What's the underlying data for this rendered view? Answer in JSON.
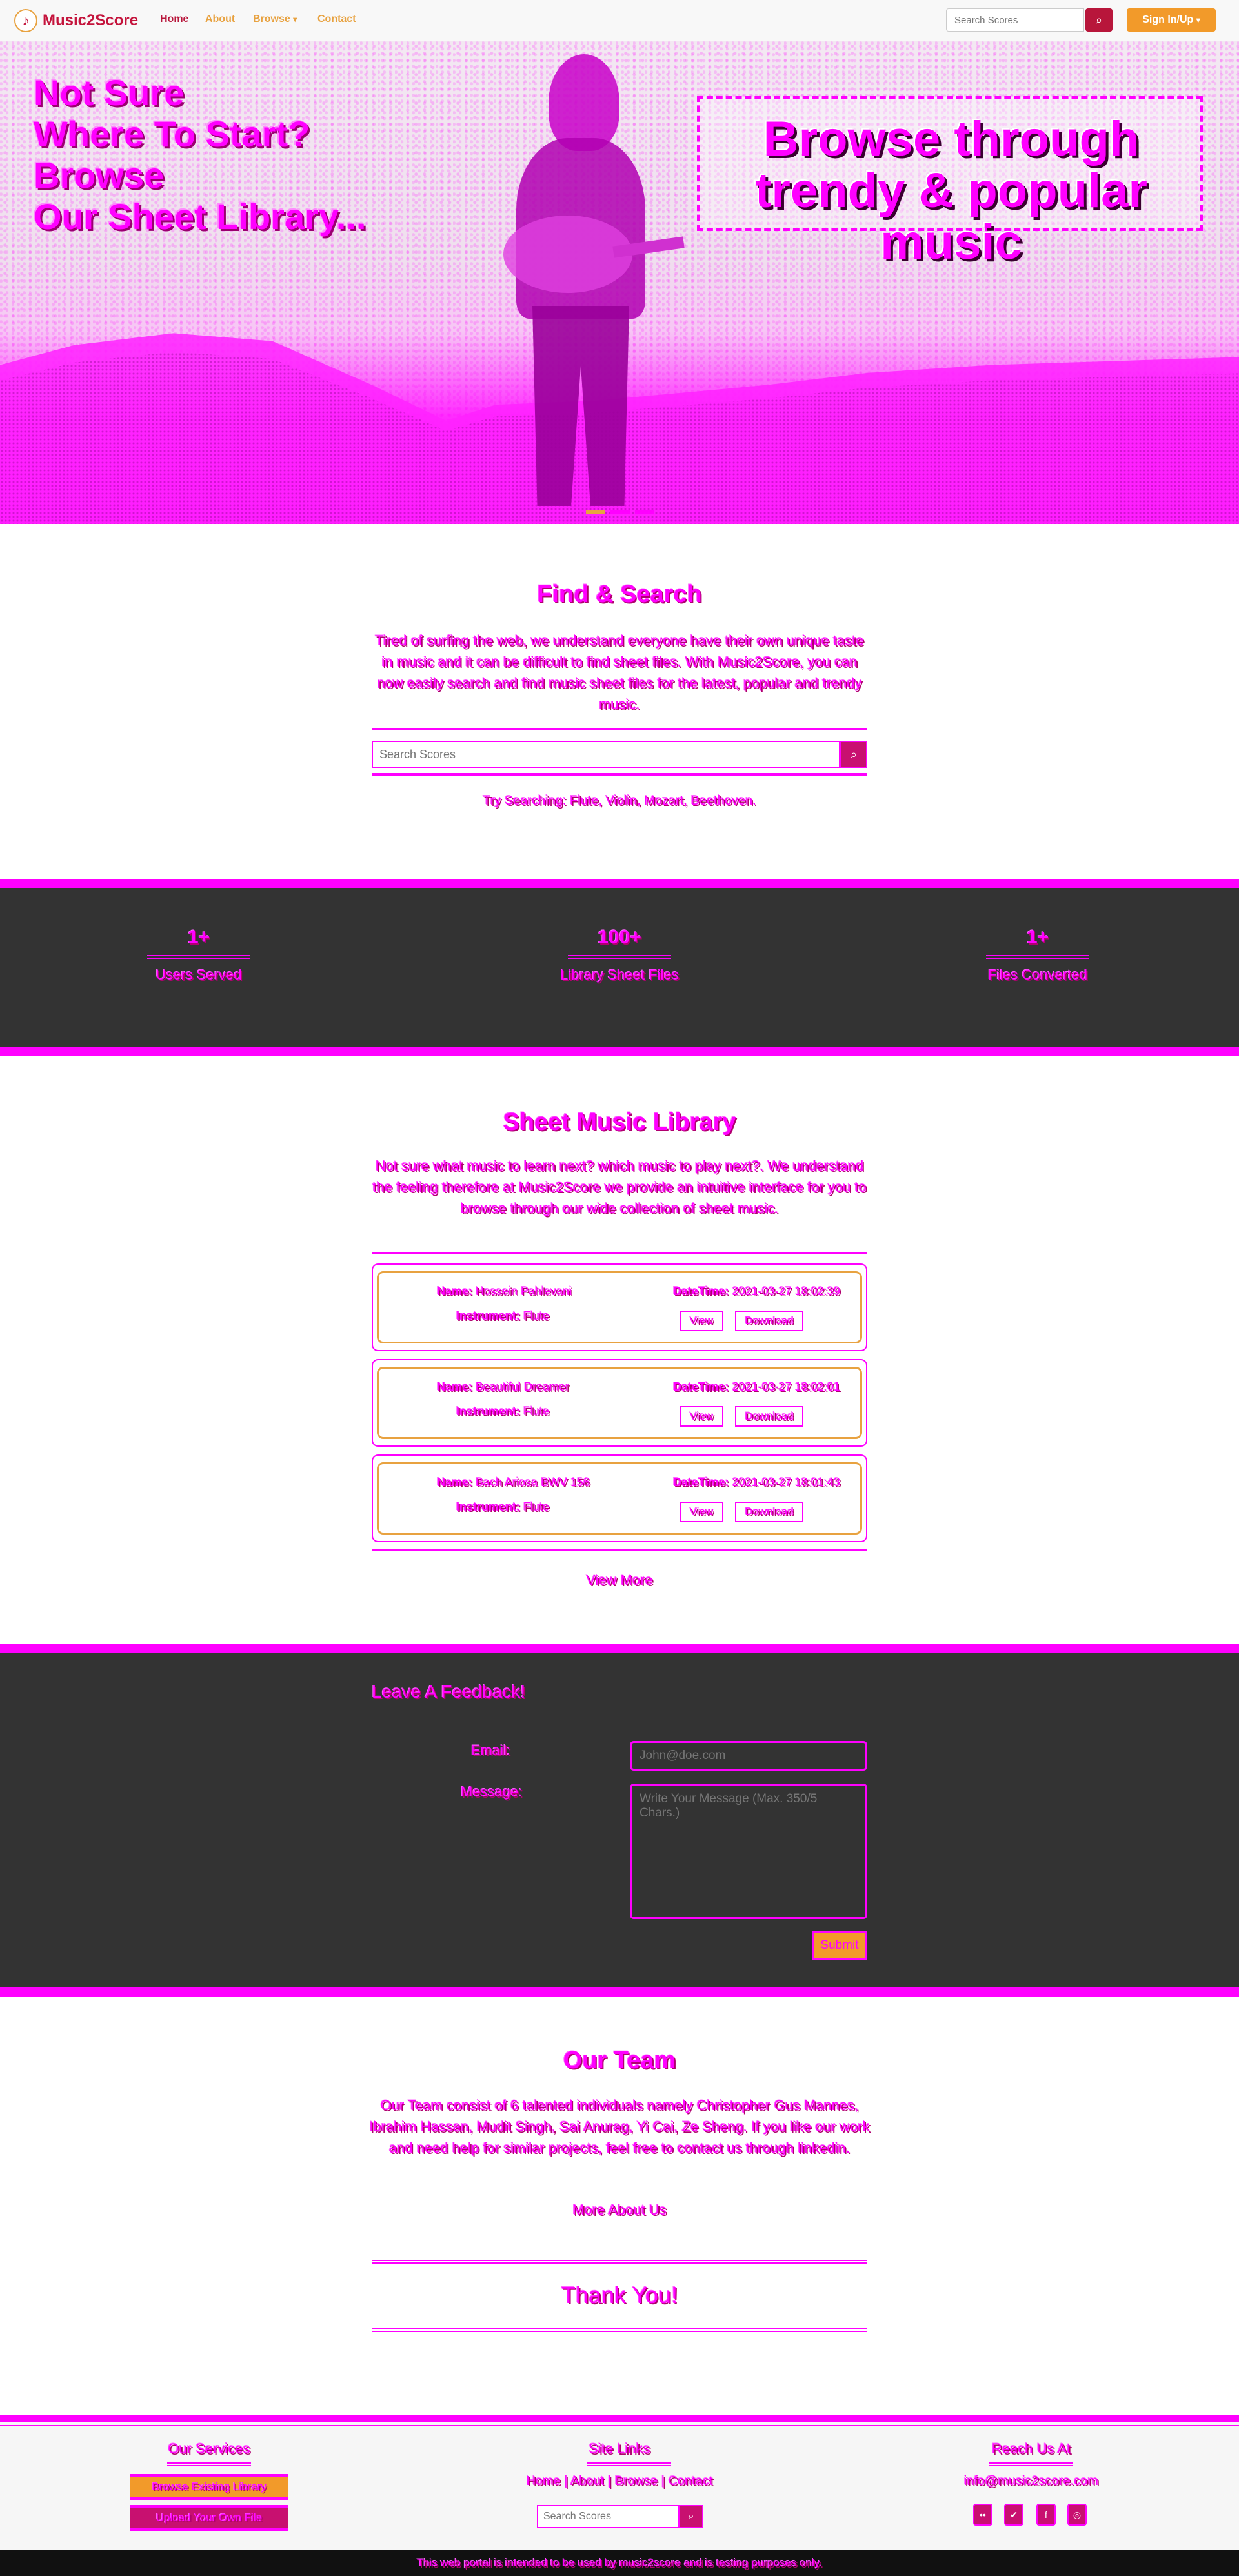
{
  "nav": {
    "brand": "Music2Score",
    "logo_icon": "music-note-icon",
    "links": [
      "Home",
      "About",
      "Browse",
      "Contact"
    ],
    "browse_caret": "▾",
    "search_placeholder": "Search Scores",
    "search_icon": "search-icon",
    "sign_label": "Sign In/Up",
    "sign_caret": "▾",
    "accent": "#b8163b",
    "orange": "#f29a2a"
  },
  "hero": {
    "left_lines": [
      "Not Sure",
      "Where To Start?",
      "Browse",
      "Our Sheet Library..."
    ],
    "right_text": "Browse through trendy & popular music",
    "slides": 3,
    "active_slide": 0
  },
  "find": {
    "title": "Find & Search",
    "text": "Tired of surfing the web, we understand everyone have their own unique taste in music and it can be difficult to find sheet files. With Music2Score, you can now easily search and find music sheet files for the latest, popular and trendy music.",
    "placeholder": "Search Scores",
    "hint": "Try Searching: Flute, Violin, Mozart, Beethoven."
  },
  "stats": [
    {
      "num": "1+",
      "label": "Users Served"
    },
    {
      "num": "100+",
      "label": "Library Sheet Files"
    },
    {
      "num": "1+",
      "label": "Files Converted"
    }
  ],
  "library": {
    "title": "Sheet Music Library",
    "text": "Not sure what music to learn next? which music to play next?. We understand the feeling therefore at Music2Score we provide an intuitive interface for you to browse through our wide collection of sheet music.",
    "name_label": "Name:",
    "instrument_label": "Instrument:",
    "date_label": "DateTime:",
    "view_label": "View",
    "download_label": "Download",
    "items": [
      {
        "name": "Hossein Pahlevani",
        "instrument": "Flute",
        "datetime": "2021-03-27 18:02:39"
      },
      {
        "name": "Beautiful Dreamer",
        "instrument": "Flute",
        "datetime": "2021-03-27 18:02:01"
      },
      {
        "name": "Bach Ariosa BWV 156",
        "instrument": "Flute",
        "datetime": "2021-03-27 18:01:43"
      }
    ],
    "more": "View More"
  },
  "feedback": {
    "title": "Leave A Feedback!",
    "email_label": "Email:",
    "email_placeholder": "John@doe.com",
    "message_label": "Message:",
    "message_placeholder": "Write Your Message (Max. 350/5 Chars.)",
    "submit": "Submit"
  },
  "team": {
    "title": "Our Team",
    "text": "Our Team consist of 6 talented individuals namely Christopher Gus Mannes, Ibrahim Hassan, Mudit Singh, Sai Anurag, Yi Cai, Ze Sheng. If you like our work and need help for similar projects, feel free to contact us through linkedin.",
    "more": "More About Us",
    "thanks": "Thank You!"
  },
  "footer": {
    "services_title": "Our Services",
    "services": [
      "Browse Existing Library",
      "Upload Your Own File"
    ],
    "sitelinks_title": "Site Links",
    "sitelinks": "Home | About | Browse | Contact",
    "search_placeholder": "Search Scores",
    "reach_title": "Reach Us At",
    "email": "info@music2score.com",
    "social_icons": [
      {
        "name": "flickr-icon",
        "glyph": "••"
      },
      {
        "name": "twitter-icon",
        "glyph": "✔"
      },
      {
        "name": "facebook-icon",
        "glyph": "f"
      },
      {
        "name": "instagram-icon",
        "glyph": "◎"
      }
    ],
    "copyright": "This web portal is intended to be used by music2score and is testing purposes only."
  }
}
